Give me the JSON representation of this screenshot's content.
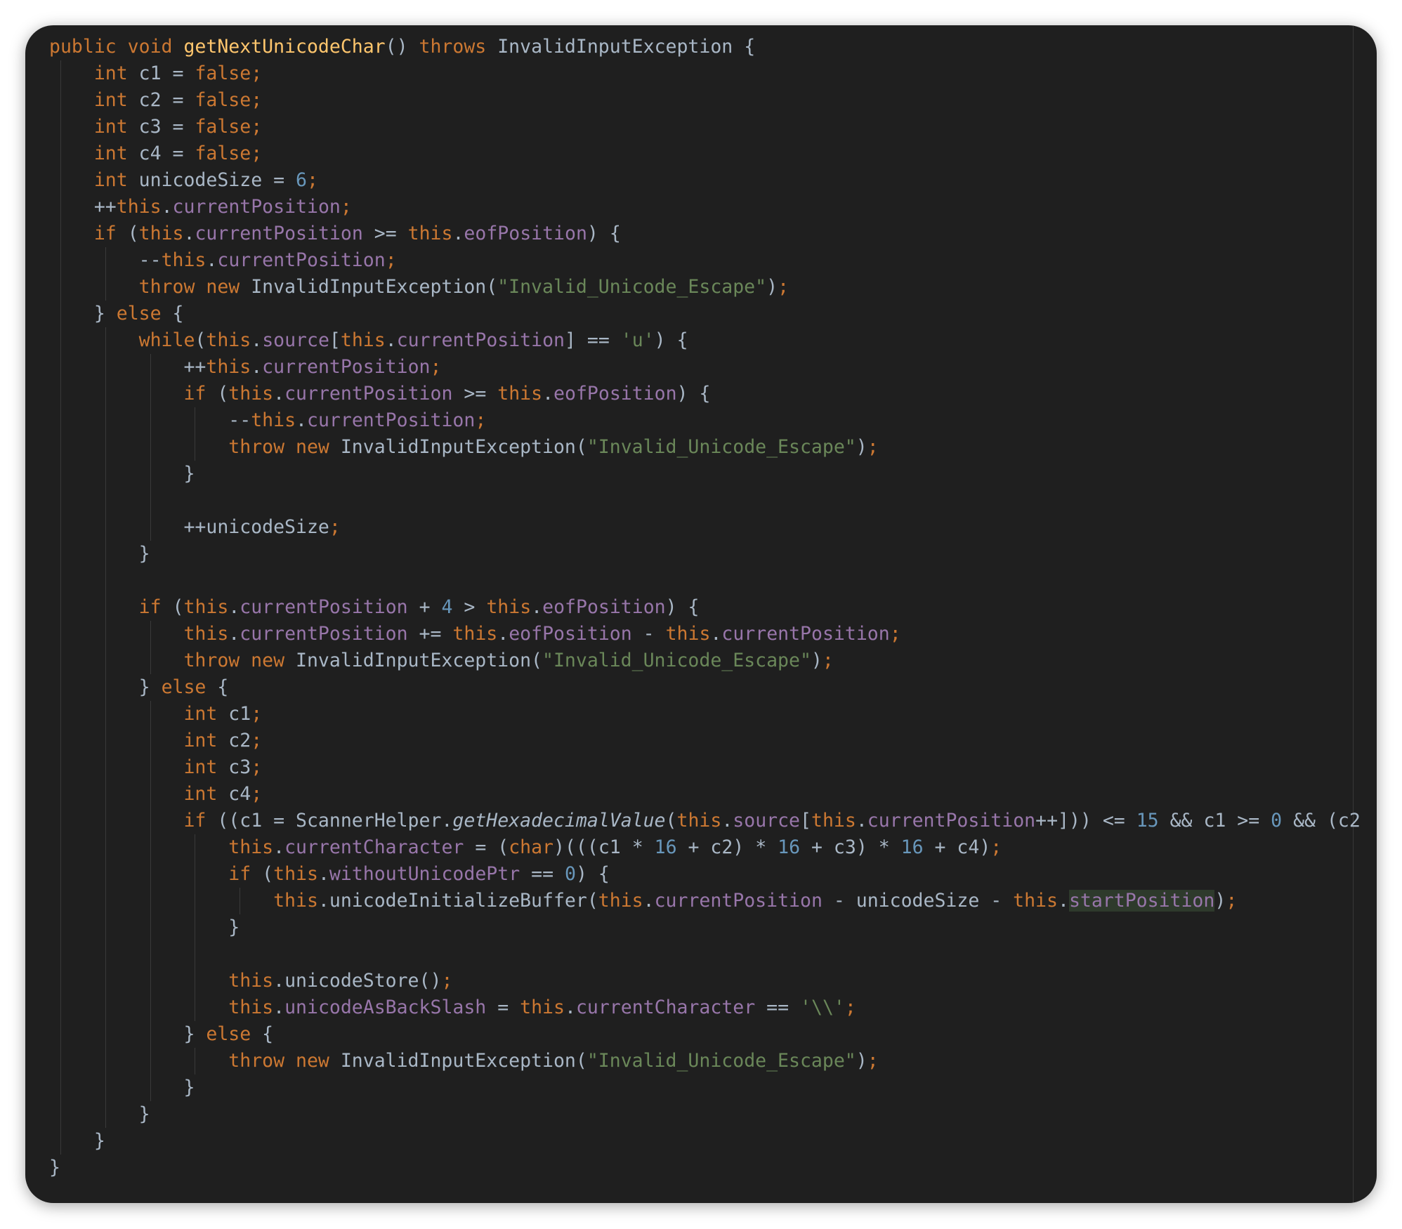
{
  "editor": {
    "lines": [
      {
        "indent": 0,
        "tokens": [
          [
            "kw",
            "public void "
          ],
          [
            "fn",
            "getNextUnicodeChar"
          ],
          [
            "plain",
            "() "
          ],
          [
            "kw",
            "throws "
          ],
          [
            "plain",
            "InvalidInputException {"
          ]
        ]
      },
      {
        "indent": 1,
        "tokens": [
          [
            "kw",
            "int "
          ],
          [
            "plain",
            "c1 = "
          ],
          [
            "kw",
            "false;"
          ]
        ]
      },
      {
        "indent": 1,
        "tokens": [
          [
            "kw",
            "int "
          ],
          [
            "plain",
            "c2 = "
          ],
          [
            "kw",
            "false;"
          ]
        ]
      },
      {
        "indent": 1,
        "tokens": [
          [
            "kw",
            "int "
          ],
          [
            "plain",
            "c3 = "
          ],
          [
            "kw",
            "false;"
          ]
        ]
      },
      {
        "indent": 1,
        "tokens": [
          [
            "kw",
            "int "
          ],
          [
            "plain",
            "c4 = "
          ],
          [
            "kw",
            "false;"
          ]
        ]
      },
      {
        "indent": 1,
        "tokens": [
          [
            "kw",
            "int "
          ],
          [
            "plain",
            "unicodeSize = "
          ],
          [
            "num",
            "6"
          ],
          [
            "kw",
            ";"
          ]
        ]
      },
      {
        "indent": 1,
        "tokens": [
          [
            "plain",
            "++"
          ],
          [
            "kw",
            "this"
          ],
          [
            "plain",
            "."
          ],
          [
            "field",
            "currentPosition"
          ],
          [
            "kw",
            ";"
          ]
        ]
      },
      {
        "indent": 1,
        "tokens": [
          [
            "kw",
            "if "
          ],
          [
            "plain",
            "("
          ],
          [
            "kw",
            "this"
          ],
          [
            "plain",
            "."
          ],
          [
            "field",
            "currentPosition"
          ],
          [
            "plain",
            " >= "
          ],
          [
            "kw",
            "this"
          ],
          [
            "plain",
            "."
          ],
          [
            "field",
            "eofPosition"
          ],
          [
            "plain",
            ") {"
          ]
        ]
      },
      {
        "indent": 2,
        "tokens": [
          [
            "plain",
            "--"
          ],
          [
            "kw",
            "this"
          ],
          [
            "plain",
            "."
          ],
          [
            "field",
            "currentPosition"
          ],
          [
            "kw",
            ";"
          ]
        ]
      },
      {
        "indent": 2,
        "tokens": [
          [
            "kw",
            "throw new "
          ],
          [
            "plain",
            "InvalidInputException("
          ],
          [
            "str",
            "\"Invalid_Unicode_Escape\""
          ],
          [
            "plain",
            ")"
          ],
          [
            "kw",
            ";"
          ]
        ]
      },
      {
        "indent": 1,
        "tokens": [
          [
            "plain",
            "} "
          ],
          [
            "kw",
            "else "
          ],
          [
            "plain",
            "{"
          ]
        ]
      },
      {
        "indent": 2,
        "tokens": [
          [
            "kw",
            "while"
          ],
          [
            "plain",
            "("
          ],
          [
            "kw",
            "this"
          ],
          [
            "plain",
            "."
          ],
          [
            "field",
            "source"
          ],
          [
            "plain",
            "["
          ],
          [
            "kw",
            "this"
          ],
          [
            "plain",
            "."
          ],
          [
            "field",
            "currentPosition"
          ],
          [
            "plain",
            "] == "
          ],
          [
            "str",
            "'u'"
          ],
          [
            "plain",
            ") {"
          ]
        ]
      },
      {
        "indent": 3,
        "tokens": [
          [
            "plain",
            "++"
          ],
          [
            "kw",
            "this"
          ],
          [
            "plain",
            "."
          ],
          [
            "field",
            "currentPosition"
          ],
          [
            "kw",
            ";"
          ]
        ]
      },
      {
        "indent": 3,
        "tokens": [
          [
            "kw",
            "if "
          ],
          [
            "plain",
            "("
          ],
          [
            "kw",
            "this"
          ],
          [
            "plain",
            "."
          ],
          [
            "field",
            "currentPosition"
          ],
          [
            "plain",
            " >= "
          ],
          [
            "kw",
            "this"
          ],
          [
            "plain",
            "."
          ],
          [
            "field",
            "eofPosition"
          ],
          [
            "plain",
            ") {"
          ]
        ]
      },
      {
        "indent": 4,
        "tokens": [
          [
            "plain",
            "--"
          ],
          [
            "kw",
            "this"
          ],
          [
            "plain",
            "."
          ],
          [
            "field",
            "currentPosition"
          ],
          [
            "kw",
            ";"
          ]
        ]
      },
      {
        "indent": 4,
        "tokens": [
          [
            "kw",
            "throw new "
          ],
          [
            "plain",
            "InvalidInputException("
          ],
          [
            "str",
            "\"Invalid_Unicode_Escape\""
          ],
          [
            "plain",
            ")"
          ],
          [
            "kw",
            ";"
          ]
        ]
      },
      {
        "indent": 3,
        "tokens": [
          [
            "plain",
            "}"
          ]
        ]
      },
      {
        "indent": 3,
        "tokens": []
      },
      {
        "indent": 3,
        "tokens": [
          [
            "plain",
            "++unicodeSize"
          ],
          [
            "kw",
            ";"
          ]
        ]
      },
      {
        "indent": 2,
        "tokens": [
          [
            "plain",
            "}"
          ]
        ]
      },
      {
        "indent": 2,
        "tokens": []
      },
      {
        "indent": 2,
        "tokens": [
          [
            "kw",
            "if "
          ],
          [
            "plain",
            "("
          ],
          [
            "kw",
            "this"
          ],
          [
            "plain",
            "."
          ],
          [
            "field",
            "currentPosition"
          ],
          [
            "plain",
            " + "
          ],
          [
            "num",
            "4"
          ],
          [
            "plain",
            " > "
          ],
          [
            "kw",
            "this"
          ],
          [
            "plain",
            "."
          ],
          [
            "field",
            "eofPosition"
          ],
          [
            "plain",
            ") {"
          ]
        ]
      },
      {
        "indent": 3,
        "tokens": [
          [
            "kw",
            "this"
          ],
          [
            "plain",
            "."
          ],
          [
            "field",
            "currentPosition"
          ],
          [
            "plain",
            " += "
          ],
          [
            "kw",
            "this"
          ],
          [
            "plain",
            "."
          ],
          [
            "field",
            "eofPosition"
          ],
          [
            "plain",
            " - "
          ],
          [
            "kw",
            "this"
          ],
          [
            "plain",
            "."
          ],
          [
            "field",
            "currentPosition"
          ],
          [
            "kw",
            ";"
          ]
        ]
      },
      {
        "indent": 3,
        "tokens": [
          [
            "kw",
            "throw new "
          ],
          [
            "plain",
            "InvalidInputException("
          ],
          [
            "str",
            "\"Invalid_Unicode_Escape\""
          ],
          [
            "plain",
            ")"
          ],
          [
            "kw",
            ";"
          ]
        ]
      },
      {
        "indent": 2,
        "tokens": [
          [
            "plain",
            "} "
          ],
          [
            "kw",
            "else "
          ],
          [
            "plain",
            "{"
          ]
        ]
      },
      {
        "indent": 3,
        "tokens": [
          [
            "kw",
            "int "
          ],
          [
            "plain",
            "c1"
          ],
          [
            "kw",
            ";"
          ]
        ]
      },
      {
        "indent": 3,
        "tokens": [
          [
            "kw",
            "int "
          ],
          [
            "plain",
            "c2"
          ],
          [
            "kw",
            ";"
          ]
        ]
      },
      {
        "indent": 3,
        "tokens": [
          [
            "kw",
            "int "
          ],
          [
            "plain",
            "c3"
          ],
          [
            "kw",
            ";"
          ]
        ]
      },
      {
        "indent": 3,
        "tokens": [
          [
            "kw",
            "int "
          ],
          [
            "plain",
            "c4"
          ],
          [
            "kw",
            ";"
          ]
        ]
      },
      {
        "indent": 3,
        "tokens": [
          [
            "kw",
            "if "
          ],
          [
            "plain",
            "((c1 = ScannerHelper."
          ],
          [
            "ital",
            "getHexadecimalValue"
          ],
          [
            "plain",
            "("
          ],
          [
            "kw",
            "this"
          ],
          [
            "plain",
            "."
          ],
          [
            "field",
            "source"
          ],
          [
            "plain",
            "["
          ],
          [
            "kw",
            "this"
          ],
          [
            "plain",
            "."
          ],
          [
            "field",
            "currentPosition"
          ],
          [
            "plain",
            "++])) <= "
          ],
          [
            "num",
            "15"
          ],
          [
            "plain",
            " && c1 >= "
          ],
          [
            "num",
            "0"
          ],
          [
            "plain",
            " && (c2 "
          ]
        ]
      },
      {
        "indent": 4,
        "tokens": [
          [
            "kw",
            "this"
          ],
          [
            "plain",
            "."
          ],
          [
            "field",
            "currentCharacter"
          ],
          [
            "plain",
            " = ("
          ],
          [
            "kw",
            "char"
          ],
          [
            "plain",
            ")(((c1 * "
          ],
          [
            "num",
            "16"
          ],
          [
            "plain",
            " + c2) * "
          ],
          [
            "num",
            "16"
          ],
          [
            "plain",
            " + c3) * "
          ],
          [
            "num",
            "16"
          ],
          [
            "plain",
            " + c4)"
          ],
          [
            "kw",
            ";"
          ]
        ]
      },
      {
        "indent": 4,
        "tokens": [
          [
            "kw",
            "if "
          ],
          [
            "plain",
            "("
          ],
          [
            "kw",
            "this"
          ],
          [
            "plain",
            "."
          ],
          [
            "field",
            "withoutUnicodePtr"
          ],
          [
            "plain",
            " == "
          ],
          [
            "num",
            "0"
          ],
          [
            "plain",
            ") {"
          ]
        ]
      },
      {
        "indent": 5,
        "tokens": [
          [
            "kw",
            "this"
          ],
          [
            "plain",
            ".unicodeInitializeBuffer("
          ],
          [
            "kw",
            "this"
          ],
          [
            "plain",
            "."
          ],
          [
            "field",
            "currentPosition"
          ],
          [
            "plain",
            " - unicodeSize - "
          ],
          [
            "kw",
            "this"
          ],
          [
            "plain",
            "."
          ],
          [
            "hl",
            "startPosition"
          ],
          [
            "plain",
            ")"
          ],
          [
            "kw",
            ";"
          ]
        ]
      },
      {
        "indent": 4,
        "tokens": [
          [
            "plain",
            "}"
          ]
        ]
      },
      {
        "indent": 4,
        "tokens": []
      },
      {
        "indent": 4,
        "tokens": [
          [
            "kw",
            "this"
          ],
          [
            "plain",
            ".unicodeStore()"
          ],
          [
            "kw",
            ";"
          ]
        ]
      },
      {
        "indent": 4,
        "tokens": [
          [
            "kw",
            "this"
          ],
          [
            "plain",
            "."
          ],
          [
            "field",
            "unicodeAsBackSlash"
          ],
          [
            "plain",
            " = "
          ],
          [
            "kw",
            "this"
          ],
          [
            "plain",
            "."
          ],
          [
            "field",
            "currentCharacter"
          ],
          [
            "plain",
            " == "
          ],
          [
            "str",
            "'\\\\'"
          ],
          [
            "kw",
            ";"
          ]
        ]
      },
      {
        "indent": 3,
        "tokens": [
          [
            "plain",
            "} "
          ],
          [
            "kw",
            "else "
          ],
          [
            "plain",
            "{"
          ]
        ]
      },
      {
        "indent": 4,
        "tokens": [
          [
            "kw",
            "throw new "
          ],
          [
            "plain",
            "InvalidInputException("
          ],
          [
            "str",
            "\"Invalid_Unicode_Escape\""
          ],
          [
            "plain",
            ")"
          ],
          [
            "kw",
            ";"
          ]
        ]
      },
      {
        "indent": 3,
        "tokens": [
          [
            "plain",
            "}"
          ]
        ]
      },
      {
        "indent": 2,
        "tokens": [
          [
            "plain",
            "}"
          ]
        ]
      },
      {
        "indent": 1,
        "tokens": [
          [
            "plain",
            "}"
          ]
        ]
      },
      {
        "indent": 0,
        "tokens": [
          [
            "plain",
            "}"
          ]
        ]
      }
    ],
    "colors": {
      "background": "#1f1f1f",
      "keyword": "#cc7832",
      "function": "#ffc66d",
      "field": "#9876aa",
      "number": "#6897bb",
      "string": "#6a8759",
      "plain": "#a9b7c6"
    }
  }
}
